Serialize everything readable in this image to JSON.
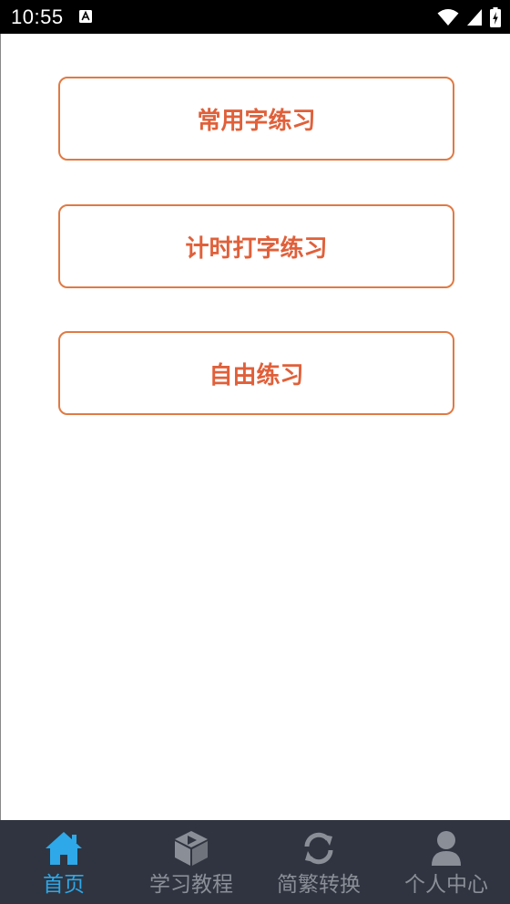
{
  "status_bar": {
    "time": "10:55",
    "notification_icon": "a-font-icon",
    "icons": [
      "wifi-icon",
      "cellular-signal-icon",
      "battery-charging-icon"
    ]
  },
  "practice_buttons": [
    {
      "label": "常用字练习"
    },
    {
      "label": "计时打字练习"
    },
    {
      "label": "自由练习"
    }
  ],
  "tab_bar": {
    "active_color": "#2ea8e8",
    "inactive_color": "#8a8e96",
    "background": "#2f3440",
    "tabs": [
      {
        "label": "首页",
        "icon": "home-icon",
        "active": true
      },
      {
        "label": "学习教程",
        "icon": "tutorial-box-icon",
        "active": false
      },
      {
        "label": "简繁转换",
        "icon": "sync-icon",
        "active": false
      },
      {
        "label": "个人中心",
        "icon": "user-icon",
        "active": false
      }
    ]
  },
  "colors": {
    "button_border": "#e07a44",
    "button_text": "#e0603a"
  }
}
